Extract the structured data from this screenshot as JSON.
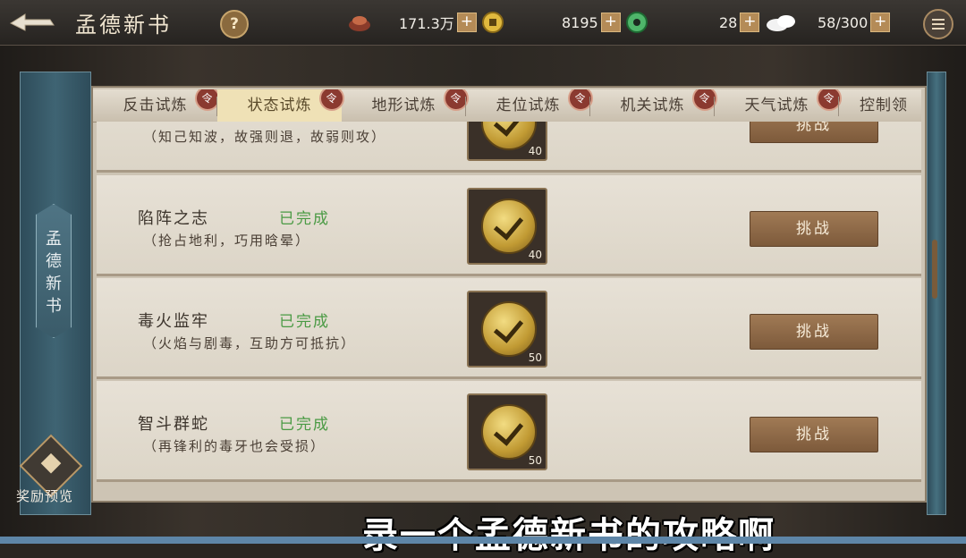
{
  "header": {
    "title": "孟德新书",
    "help": "?",
    "resources": [
      {
        "icon": "silver-ingot-icon",
        "value": "171.3万"
      },
      {
        "icon": "gold-coin-icon",
        "value": "8195"
      },
      {
        "icon": "jade-icon",
        "value": "28"
      },
      {
        "icon": "stamina-cloud-icon",
        "value": "58/300"
      }
    ],
    "plus": "+"
  },
  "sidebar": {
    "tab_label": "孟德新书",
    "reward_label": "奖励预览"
  },
  "tabs": [
    {
      "label": "反击试炼",
      "badge": "令"
    },
    {
      "label": "状态试炼",
      "badge": "令",
      "active": true
    },
    {
      "label": "地形试炼",
      "badge": "令"
    },
    {
      "label": "走位试炼",
      "badge": "令"
    },
    {
      "label": "机关试炼",
      "badge": "令"
    },
    {
      "label": "天气试炼",
      "badge": "令"
    },
    {
      "label": "控制领"
    }
  ],
  "rows": [
    {
      "name": "",
      "status": "",
      "desc": "（知己知波，故强则退，故弱则攻）",
      "reward_count": "40",
      "button": "挑战"
    },
    {
      "name": "陷阵之志",
      "status": "已完成",
      "desc": "（抢占地利，巧用晗晕）",
      "reward_count": "40",
      "button": "挑战"
    },
    {
      "name": "毒火监牢",
      "status": "已完成",
      "desc": "（火焰与剧毒，互助方可抵抗）",
      "reward_count": "50",
      "button": "挑战"
    },
    {
      "name": "智斗群蛇",
      "status": "已完成",
      "desc": "（再锋利的毒牙也会受损）",
      "reward_count": "50",
      "button": "挑战"
    }
  ],
  "subtitle": "录一个孟德新书的攻略啊",
  "colors": {
    "status_green": "#4a9a44",
    "button_brown": "#8c6846",
    "frame_teal": "#3f6473"
  }
}
